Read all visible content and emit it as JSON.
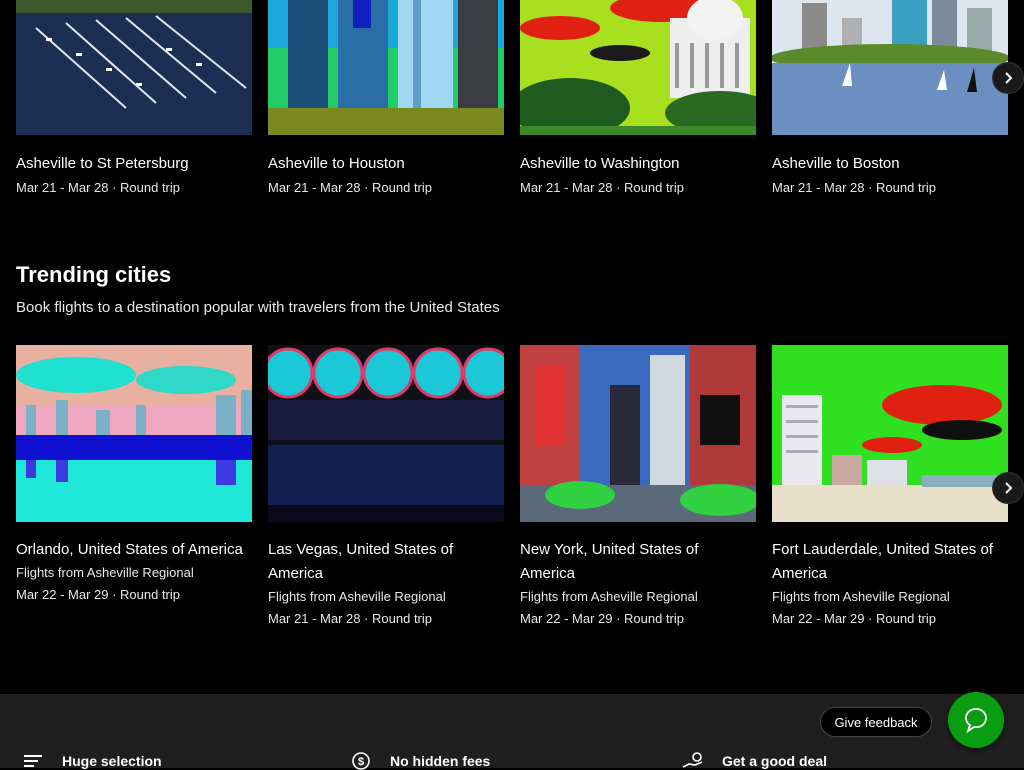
{
  "top_carousel": {
    "cards": [
      {
        "title": "Asheville to St Petersburg",
        "subtitle": "Mar 21 - Mar 28 · Round trip",
        "image": "marina-harbor-photo"
      },
      {
        "title": "Asheville to Houston",
        "subtitle": "Mar 21 - Mar 28 · Round trip",
        "image": "houston-skyscrapers-photo"
      },
      {
        "title": "Asheville to Washington",
        "subtitle": "Mar 21 - Mar 28 · Round trip",
        "image": "capitol-building-photo"
      },
      {
        "title": "Asheville to Boston",
        "subtitle": "Mar 21 - Mar 28 · Round trip",
        "image": "boston-river-photo"
      }
    ],
    "next_icon": "chevron-right-icon"
  },
  "trending": {
    "title": "Trending cities",
    "subtitle": "Book flights to a destination popular with travelers from the United States",
    "cards": [
      {
        "title": "Orlando, United States of America",
        "origin": "Flights from Asheville Regional",
        "dates": "Mar 22 - Mar 29 · Round trip",
        "image": "orlando-lake-skyline-photo"
      },
      {
        "title": "Las Vegas, United States of America",
        "origin": "Flights from Asheville Regional",
        "dates": "Mar 21 - Mar 28 · Round trip",
        "image": "las-vegas-sign-photo"
      },
      {
        "title": "New York, United States of America",
        "origin": "Flights from Asheville Regional",
        "dates": "Mar 22 - Mar 29 · Round trip",
        "image": "times-square-photo"
      },
      {
        "title": "Fort Lauderdale, United States of America",
        "origin": "Flights from Asheville Regional",
        "dates": "Mar 22 - Mar 29 · Round trip",
        "image": "fort-lauderdale-beach-photo"
      }
    ],
    "next_icon": "chevron-right-icon"
  },
  "footer": {
    "features": [
      {
        "label": "Huge selection",
        "icon": "list-icon"
      },
      {
        "label": "No hidden fees",
        "icon": "dollar-circle-icon"
      },
      {
        "label": "Get a good deal",
        "icon": "hand-coins-icon"
      }
    ]
  },
  "feedback": {
    "label": "Give feedback"
  },
  "chat": {
    "icon": "chat-bubble-icon"
  },
  "colors": {
    "background": "#000000",
    "footer_background": "#1f1f1f",
    "accent_green": "#0a9d12",
    "text": "#ffffff"
  }
}
